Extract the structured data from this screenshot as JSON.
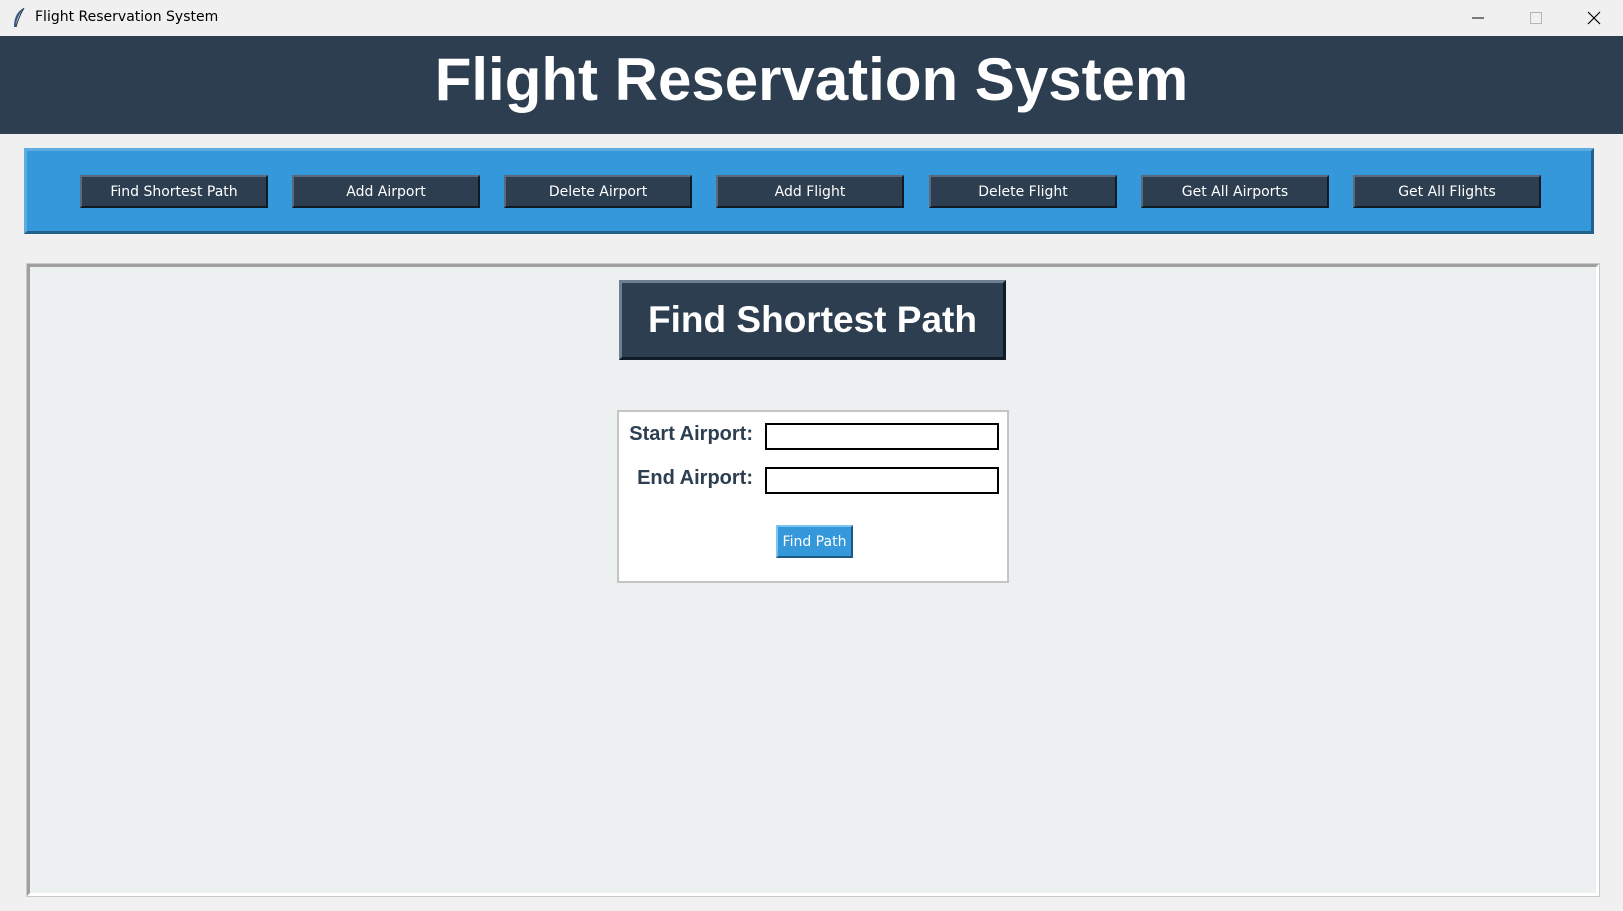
{
  "window": {
    "title": "Flight Reservation System",
    "icon": "feather-icon"
  },
  "header": {
    "title": "Flight Reservation System"
  },
  "nav": {
    "buttons": [
      {
        "label": "Find Shortest Path"
      },
      {
        "label": "Add Airport"
      },
      {
        "label": "Delete Airport"
      },
      {
        "label": "Add Flight"
      },
      {
        "label": "Delete Flight"
      },
      {
        "label": "Get All Airports"
      },
      {
        "label": "Get All Flights"
      }
    ]
  },
  "main": {
    "section_title": "Find Shortest Path",
    "form": {
      "start_label": "Start Airport:",
      "start_value": "",
      "end_label": "End Airport:",
      "end_value": "",
      "submit_label": "Find Path"
    }
  },
  "colors": {
    "header_bg": "#2c3e50",
    "nav_bg": "#3498db",
    "content_bg": "#ecf0f1",
    "button_bg": "#2c3e50",
    "accent_button_bg": "#3498db"
  }
}
